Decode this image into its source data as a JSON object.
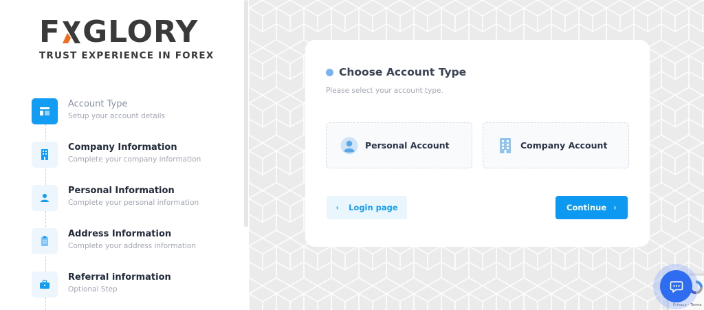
{
  "brand": {
    "logo_left": "FX",
    "logo_right": "GLORY",
    "tagline": "TRUST EXPERIENCE IN FOREX",
    "accent_color": "#f26b1d",
    "text_color": "#3a3a3a"
  },
  "steps": [
    {
      "title": "Account Type",
      "desc": "Setup your account details",
      "icon": "layout-icon",
      "active": true
    },
    {
      "title": "Company Information",
      "desc": "Complete your company information",
      "icon": "building-icon",
      "active": false
    },
    {
      "title": "Personal Information",
      "desc": "Complete your personal information",
      "icon": "user-icon",
      "active": false
    },
    {
      "title": "Address Information",
      "desc": "Complete your address information",
      "icon": "clipboard-icon",
      "active": false
    },
    {
      "title": "Referral information",
      "desc": "Optional Step",
      "icon": "briefcase-icon",
      "active": false
    }
  ],
  "card": {
    "title": "Choose Account Type",
    "subtitle": "Please select your account type.",
    "options": [
      {
        "label": "Personal Account",
        "icon": "user-avatar-icon"
      },
      {
        "label": "Company Account",
        "icon": "building-icon"
      }
    ],
    "back_label": "Login page",
    "continue_label": "Continue"
  },
  "recaptcha": {
    "privacy": "Privacy",
    "separator": " - ",
    "terms": "Terms"
  },
  "colors": {
    "primary": "#0d98f1",
    "active_step": "#139cf3",
    "chat": "#2e6df0"
  }
}
